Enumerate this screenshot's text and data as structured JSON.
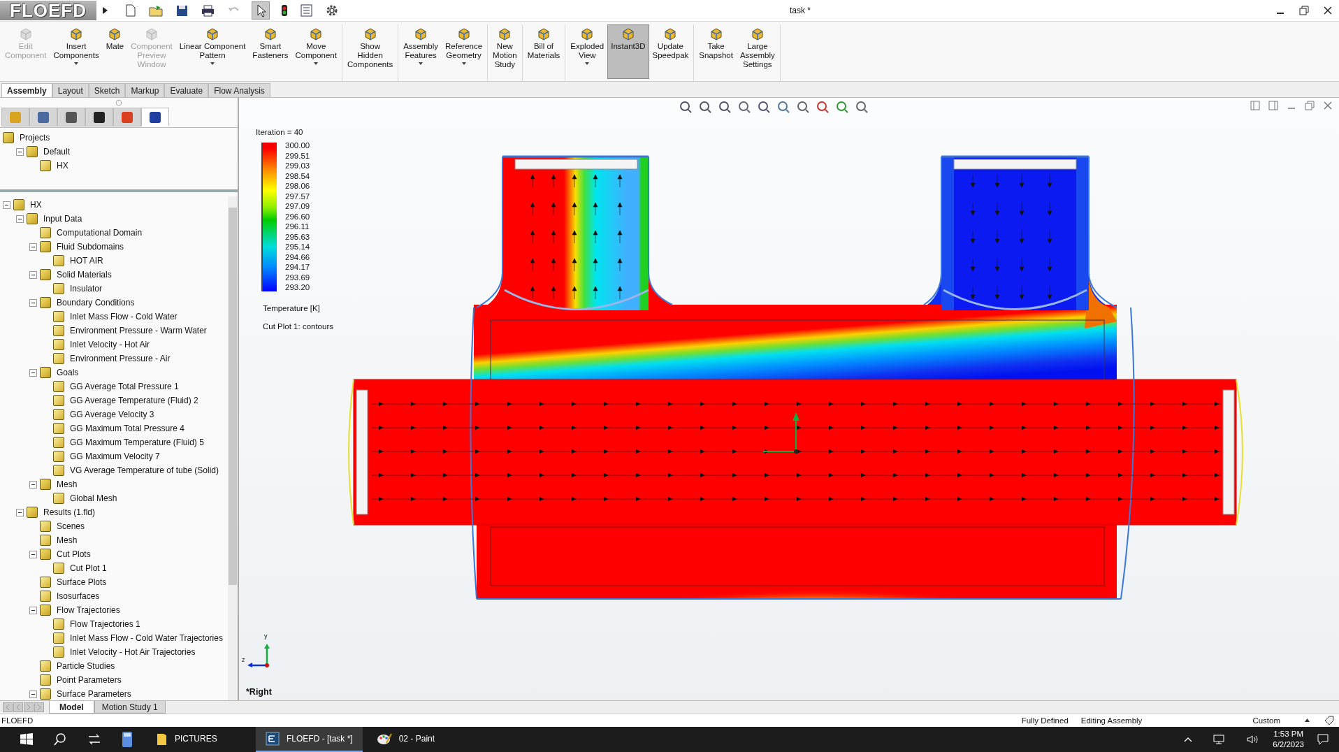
{
  "window": {
    "logo": "FLOEFD",
    "title": "task *"
  },
  "ribbon_groups": [
    {
      "buttons": [
        {
          "lines": [
            "Edit",
            "Component"
          ],
          "disabled": true,
          "selected": false,
          "dropdown": false
        },
        {
          "lines": [
            "Insert",
            "Components"
          ],
          "disabled": false,
          "selected": false,
          "dropdown": true
        },
        {
          "lines": [
            "Mate"
          ],
          "disabled": false,
          "selected": false,
          "dropdown": false
        },
        {
          "lines": [
            "Component",
            "Preview",
            "Window"
          ],
          "disabled": true,
          "selected": false,
          "dropdown": false
        },
        {
          "lines": [
            "Linear Component",
            "Pattern"
          ],
          "disabled": false,
          "selected": false,
          "dropdown": true
        },
        {
          "lines": [
            "Smart",
            "Fasteners"
          ],
          "disabled": false,
          "selected": false,
          "dropdown": false
        },
        {
          "lines": [
            "Move",
            "Component"
          ],
          "disabled": false,
          "selected": false,
          "dropdown": true
        }
      ]
    },
    {
      "buttons": [
        {
          "lines": [
            "Show",
            "Hidden",
            "Components"
          ],
          "disabled": false,
          "selected": false,
          "dropdown": false
        }
      ]
    },
    {
      "buttons": [
        {
          "lines": [
            "Assembly",
            "Features"
          ],
          "disabled": false,
          "selected": false,
          "dropdown": true
        },
        {
          "lines": [
            "Reference",
            "Geometry"
          ],
          "disabled": false,
          "selected": false,
          "dropdown": true
        }
      ]
    },
    {
      "buttons": [
        {
          "lines": [
            "New",
            "Motion",
            "Study"
          ],
          "disabled": false,
          "selected": false,
          "dropdown": false
        }
      ]
    },
    {
      "buttons": [
        {
          "lines": [
            "Bill of",
            "Materials"
          ],
          "disabled": false,
          "selected": false,
          "dropdown": false
        }
      ]
    },
    {
      "buttons": [
        {
          "lines": [
            "Exploded",
            "View"
          ],
          "disabled": false,
          "selected": false,
          "dropdown": true
        },
        {
          "lines": [
            "Instant3D"
          ],
          "disabled": false,
          "selected": true,
          "dropdown": false
        },
        {
          "lines": [
            "Update",
            "Speedpak"
          ],
          "disabled": false,
          "selected": false,
          "dropdown": false
        }
      ]
    },
    {
      "buttons": [
        {
          "lines": [
            "Take",
            "Snapshot"
          ],
          "disabled": false,
          "selected": false,
          "dropdown": false
        },
        {
          "lines": [
            "Large",
            "Assembly",
            "Settings"
          ],
          "disabled": false,
          "selected": false,
          "dropdown": false
        }
      ]
    }
  ],
  "tabs": [
    {
      "label": "Assembly",
      "selected": true
    },
    {
      "label": "Layout",
      "selected": false
    },
    {
      "label": "Sketch",
      "selected": false
    },
    {
      "label": "Markup",
      "selected": false
    },
    {
      "label": "Evaluate",
      "selected": false
    },
    {
      "label": "Flow Analysis",
      "selected": false
    }
  ],
  "panel_tabs": [
    {
      "selected": false
    },
    {
      "selected": false
    },
    {
      "selected": false
    },
    {
      "selected": false
    },
    {
      "selected": false
    },
    {
      "selected": true
    }
  ],
  "projects_tree": {
    "items": [
      {
        "label": "Projects",
        "sub": [
          {
            "label": "Default",
            "expanded": true,
            "children": [
              {
                "label": "HX"
              }
            ]
          }
        ]
      }
    ]
  },
  "tree": {
    "items": [
      {
        "label": "HX",
        "expanded": true,
        "children": [
          {
            "label": "Input Data",
            "expanded": true,
            "children": [
              {
                "label": "Computational Domain"
              },
              {
                "label": "Fluid Subdomains",
                "expanded": true,
                "children": [
                  {
                    "label": "HOT AIR"
                  }
                ]
              },
              {
                "label": "Solid Materials",
                "expanded": true,
                "children": [
                  {
                    "label": "Insulator"
                  }
                ]
              },
              {
                "label": "Boundary Conditions",
                "expanded": true,
                "children": [
                  {
                    "label": "Inlet Mass Flow - Cold Water"
                  },
                  {
                    "label": "Environment Pressure - Warm Water"
                  },
                  {
                    "label": "Inlet Velocity - Hot Air"
                  },
                  {
                    "label": "Environment Pressure - Air"
                  }
                ]
              },
              {
                "label": "Goals",
                "expanded": true,
                "children": [
                  {
                    "label": "GG Average Total Pressure 1"
                  },
                  {
                    "label": "GG Average Temperature (Fluid) 2"
                  },
                  {
                    "label": "GG Average Velocity 3"
                  },
                  {
                    "label": "GG Maximum Total Pressure 4"
                  },
                  {
                    "label": "GG Maximum Temperature (Fluid) 5"
                  },
                  {
                    "label": "GG Maximum Velocity 7"
                  },
                  {
                    "label": "VG Average Temperature of tube (Solid)"
                  }
                ]
              },
              {
                "label": "Mesh",
                "expanded": true,
                "children": [
                  {
                    "label": "Global Mesh"
                  }
                ]
              }
            ]
          },
          {
            "label": "Results (1.fld)",
            "expanded": true,
            "children": [
              {
                "label": "Scenes"
              },
              {
                "label": "Mesh"
              },
              {
                "label": "Cut Plots",
                "expanded": true,
                "children": [
                  {
                    "label": "Cut Plot 1"
                  }
                ]
              },
              {
                "label": "Surface Plots"
              },
              {
                "label": "Isosurfaces"
              },
              {
                "label": "Flow Trajectories",
                "expanded": true,
                "children": [
                  {
                    "label": "Flow Trajectories 1"
                  },
                  {
                    "label": "Inlet Mass Flow - Cold Water Trajectories"
                  },
                  {
                    "label": "Inlet Velocity - Hot Air Trajectories"
                  }
                ]
              },
              {
                "label": "Particle Studies"
              },
              {
                "label": "Point Parameters"
              },
              {
                "label": "Surface Parameters",
                "expanded": true
              }
            ]
          }
        ]
      }
    ]
  },
  "viewport": {
    "iteration": "Iteration = 40",
    "legend": {
      "labels": [
        "300.00",
        "299.51",
        "299.03",
        "298.54",
        "298.06",
        "297.57",
        "297.09",
        "296.60",
        "296.11",
        "295.63",
        "295.14",
        "294.66",
        "294.17",
        "293.69",
        "293.20"
      ],
      "title": "Temperature [K]",
      "caption": "Cut Plot 1: contours"
    },
    "triad": {
      "y": "y",
      "z": "z"
    },
    "view_name": "*Right"
  },
  "bottom_tabs": [
    {
      "label": "Model",
      "selected": true
    },
    {
      "label": "Motion Study 1",
      "selected": false
    }
  ],
  "status_bar": {
    "app": "FLOEFD",
    "fields": [
      "Fully Defined",
      "Editing Assembly"
    ],
    "units": "Custom"
  },
  "taskbar": {
    "apps": [
      {
        "label": "PICTURES",
        "kind": "folder",
        "selected": false
      },
      {
        "label": "FLOEFD - [task *]",
        "kind": "floefd",
        "selected": true
      },
      {
        "label": "02 - Paint",
        "kind": "paint",
        "selected": false
      }
    ],
    "time": "1:53 PM",
    "date": "6/2/2023"
  }
}
